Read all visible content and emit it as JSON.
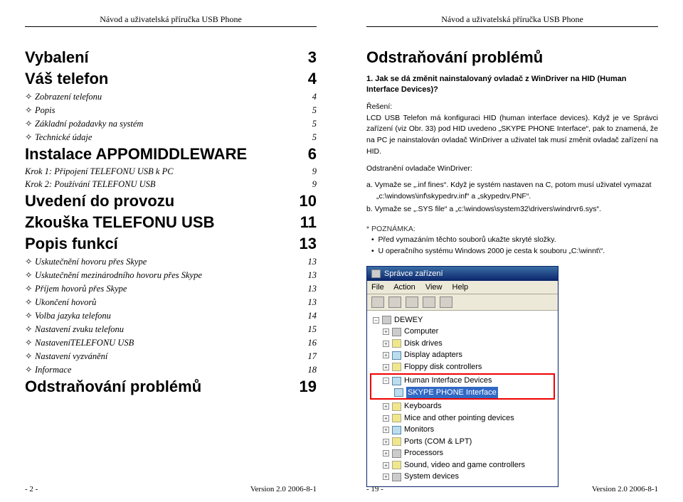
{
  "header": "Návod a uživatelská příručka USB Phone",
  "left": {
    "toc": [
      {
        "title": "Vybalení",
        "page": "3",
        "type": "h"
      },
      {
        "title": "Váš telefon",
        "page": "4",
        "type": "h"
      },
      {
        "title": "Zobrazení telefonu",
        "page": "4",
        "type": "b"
      },
      {
        "title": "Popis",
        "page": "5",
        "type": "b"
      },
      {
        "title": "Základní požadavky na systém",
        "page": "5",
        "type": "b"
      },
      {
        "title": "Technické údaje",
        "page": "5",
        "type": "b"
      },
      {
        "title": "Instalace APPOMIDDLEWARE",
        "page": "6",
        "type": "h"
      },
      {
        "title": "Krok 1: Připojení TELEFONU USB k PC",
        "page": "9",
        "type": "i"
      },
      {
        "title": "Krok 2: Používání TELEFONU USB",
        "page": "9",
        "type": "i"
      },
      {
        "title": "Uvedení do provozu",
        "page": "10",
        "type": "h"
      },
      {
        "title": "Zkouška TELEFONU USB",
        "page": "11",
        "type": "h"
      },
      {
        "title": "Popis funkcí",
        "page": "13",
        "type": "h"
      },
      {
        "title": "Uskutečnění hovoru přes Skype",
        "page": "13",
        "type": "b"
      },
      {
        "title": "Uskutečnění mezinárodního hovoru přes Skype",
        "page": "13",
        "type": "b"
      },
      {
        "title": "Příjem hovorů přes Skype",
        "page": "13",
        "type": "b"
      },
      {
        "title": "Ukončení hovorů",
        "page": "13",
        "type": "b"
      },
      {
        "title": "Volba jazyka telefonu",
        "page": "14",
        "type": "b"
      },
      {
        "title": "Nastavení zvuku telefonu",
        "page": "15",
        "type": "b"
      },
      {
        "title": "NastaveníTELEFONU USB",
        "page": "16",
        "type": "b"
      },
      {
        "title": "Nastavení vyzvánění",
        "page": "17",
        "type": "b"
      },
      {
        "title": "Informace",
        "page": "18",
        "type": "b"
      },
      {
        "title": "Odstraňování problémů",
        "page": "19",
        "type": "h"
      }
    ],
    "footerPage": "- 2 -",
    "footerVersion": "Version 2.0  2006-8-1"
  },
  "right": {
    "title": "Odstraňování problémů",
    "q": "1. Jak se dá změnit nainstalovaný ovladač z WinDriver na HID (Human Interface Devices)?",
    "solTitle": "Řešení:",
    "sol": "LCD USB Telefon má konfiguraci HID (human interface devices). Když je ve Správci zařízení (viz Obr. 33) pod HID uvedeno „SKYPE PHONE Interface“, pak to znamená, že na PC je nainstalován ovladač WinDriver a uživatel tak musí změnit ovladač zařízení na HID.",
    "remTitle": "Odstranění ovladače WinDriver:",
    "a": "a.  Vymaže se „.inf fines“. Když je systém nastaven na C, potom musí uživatel vymazat „c:\\windows\\inf\\skypedrv.inf“ a „skypedrv.PNF“.",
    "b": "b.  Vymaže se „.SYS file“ a „c:\\windows\\system32\\drivers\\windrvr6.sys“.",
    "noteTitle": "* POZNÁMKA:",
    "note1": "Před vymazáním těchto souborů ukažte skryté složky.",
    "note2": "U operačního systému Windows 2000 je cesta k souboru „C:\\winnt\\“.",
    "win": {
      "title": "Správce zařízení",
      "menu": [
        "File",
        "Action",
        "View",
        "Help"
      ],
      "root": "DEWEY",
      "items": [
        "Computer",
        "Disk drives",
        "Display adapters",
        "Floppy disk controllers",
        "Human Interface Devices",
        "SKYPE PHONE Interface",
        "Keyboards",
        "Mice and other pointing devices",
        "Monitors",
        "Ports (COM & LPT)",
        "Processors",
        "Sound, video and game controllers",
        "System devices"
      ]
    },
    "footerPage": "- 19 -",
    "footerVersion": "Version 2.0  2006-8-1"
  }
}
